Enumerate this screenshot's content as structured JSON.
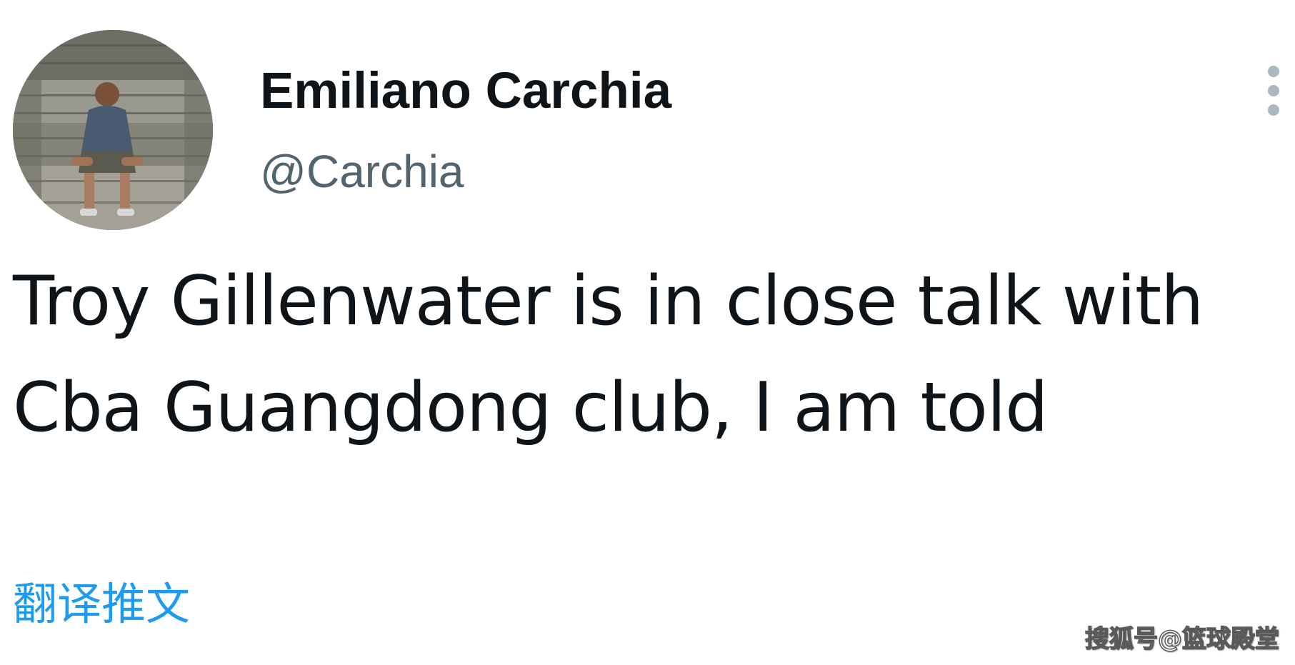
{
  "author": {
    "display_name": "Emiliano Carchia",
    "handle": "@Carchia",
    "avatar_icon": "profile-photo"
  },
  "tweet": {
    "text": "Troy Gillenwater is in close talk with Cba Guangdong club, I am told",
    "translate_label": "翻译推文"
  },
  "menu": {
    "icon": "vertical-ellipsis-icon"
  },
  "watermark": {
    "text": "搜狐号@篮球殿堂"
  },
  "colors": {
    "text_primary": "#0f1419",
    "text_secondary": "#536471",
    "link": "#1d9bf0",
    "menu_dots": "#aab8c2",
    "background": "#ffffff"
  }
}
